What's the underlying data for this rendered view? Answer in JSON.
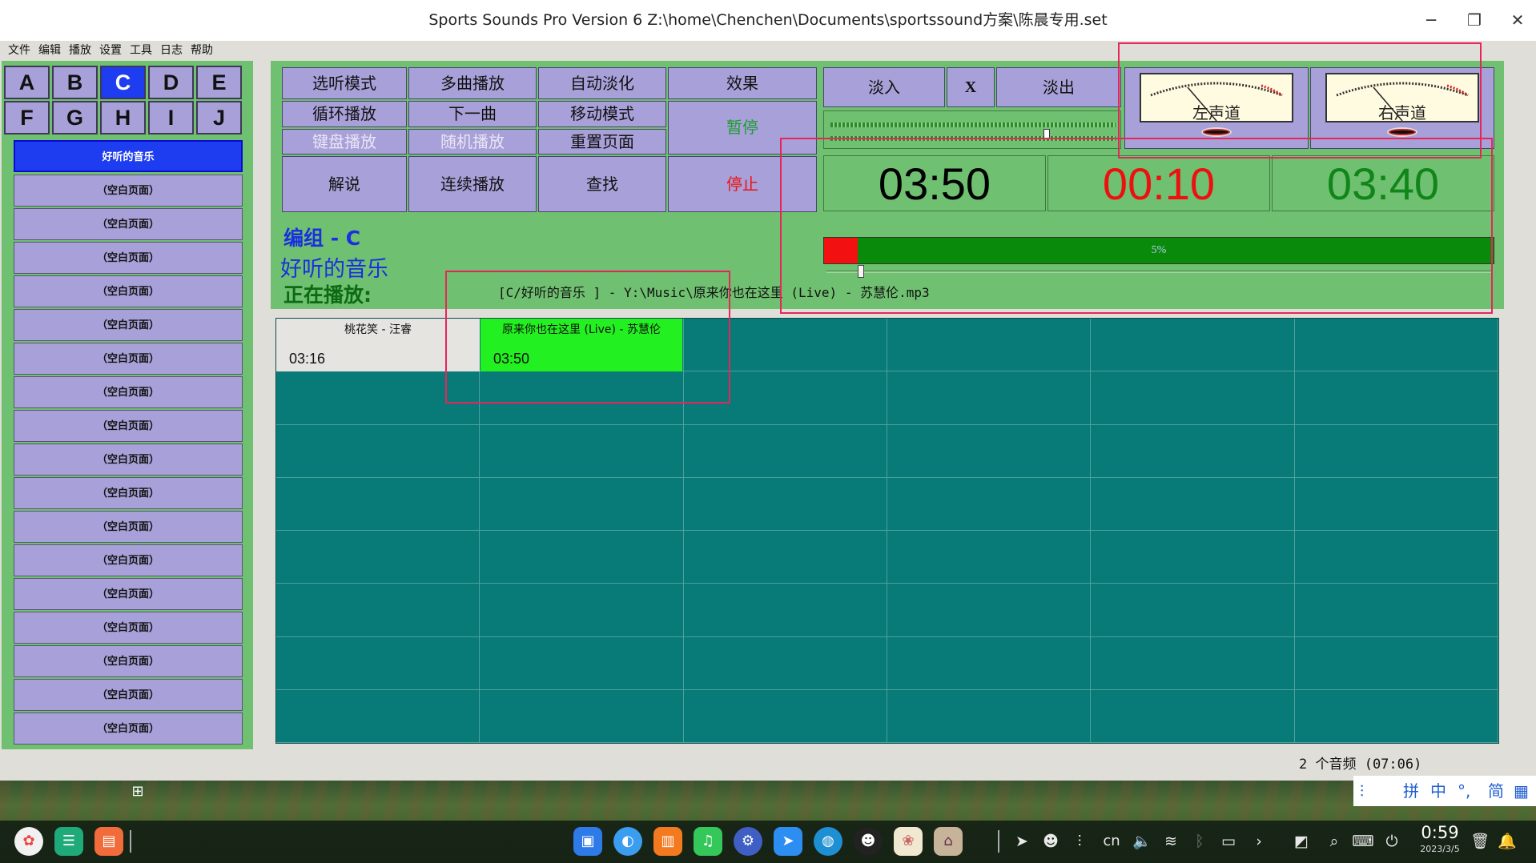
{
  "window": {
    "title": "Sports Sounds Pro Version 6 Z:\\home\\Chenchen\\Documents\\sportssound方案\\陈晨专用.set",
    "minimize": "─",
    "restore": "❐",
    "close": "✕"
  },
  "menu": [
    "文件",
    "编辑",
    "播放",
    "设置",
    "工具",
    "日志",
    "帮助"
  ],
  "letters": [
    "A",
    "B",
    "C",
    "D",
    "E",
    "F",
    "G",
    "H",
    "I",
    "J"
  ],
  "active_letter": "C",
  "pages": {
    "active": "好听的音乐",
    "empty": "（空白页面）"
  },
  "controls": {
    "row1": [
      "选听模式",
      "多曲播放",
      "自动淡化",
      "效果"
    ],
    "row2": [
      "循环播放",
      "下一曲",
      "移动模式"
    ],
    "row3": [
      "键盘播放",
      "随机播放",
      "重置页面"
    ],
    "pause": "暂停",
    "row4": [
      "解说",
      "连续播放",
      "查找"
    ],
    "stop": "停止",
    "fade_in": "淡入",
    "x": "X",
    "fade_out": "淡出"
  },
  "vu": {
    "left": "左声道",
    "right": "右声道"
  },
  "times": {
    "total": "03:50",
    "elapsed": "00:10",
    "remaining": "03:40"
  },
  "progress": {
    "percent_label": "5%",
    "fraction": 0.05
  },
  "group": {
    "label": "编组 - C",
    "name": "好听的音乐",
    "playing_label": "正在播放:"
  },
  "now_playing": "[C/好听的音乐 ] - Y:\\Music\\原来你也在这里 (Live) - 苏慧伦.mp3",
  "tiles": [
    {
      "title": "桃花笑 - 汪睿",
      "duration": "03:16"
    },
    {
      "title": "原来你也在这里 (Live) - 苏慧伦",
      "duration": "03:50"
    }
  ],
  "status": "2 个音频 (07:06)",
  "colors": {
    "panel": "#6fc070",
    "button": "#a8a0d8",
    "active": "#1e3cf0",
    "grid": "#087a78",
    "playing_tile": "#22f020",
    "elapsed": "#ee1010",
    "remaining": "#11851a"
  },
  "taskbar": {
    "apps": [
      "launcher-icon",
      "files-icon",
      "app-store-icon"
    ],
    "center": [
      "calendar-icon",
      "browser-icon",
      "store-icon",
      "music-icon",
      "settings-icon",
      "feishu-icon",
      "edge-icon",
      "qq-icon",
      "image-viewer-icon",
      "house-icon"
    ],
    "tray_text": {
      "lang": "cn",
      "clock": "0:59",
      "date": "2023/3/5"
    }
  },
  "ime": {
    "chars": [
      "拼",
      "中",
      "°,",
      "简"
    ]
  }
}
